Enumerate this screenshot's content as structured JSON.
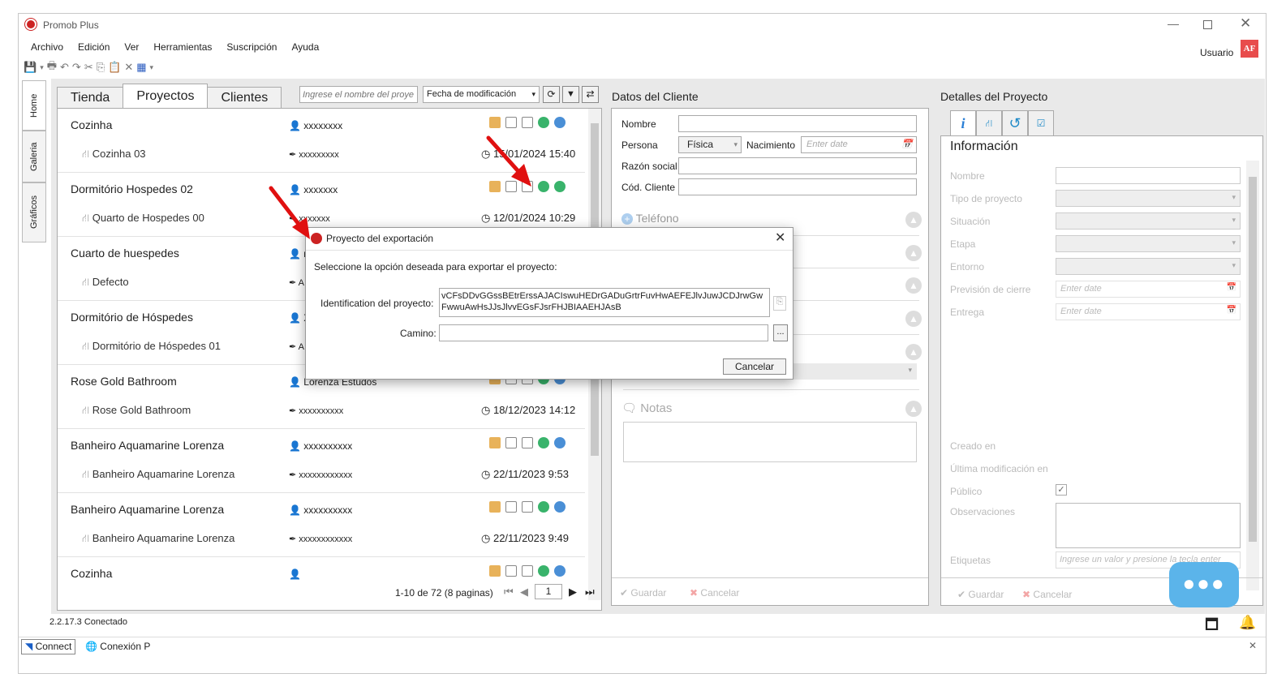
{
  "app": {
    "title": "Promob Plus",
    "user": "Usuario",
    "user_badge": "AF"
  },
  "menu": [
    "Archivo",
    "Edición",
    "Ver",
    "Herramientas",
    "Suscripción",
    "Ayuda"
  ],
  "side_tabs": [
    "Home",
    "Galeria",
    "Gráficos"
  ],
  "projects": {
    "tabs": [
      "Tienda",
      "Proyectos",
      "Clientes"
    ],
    "search_placeholder": "Ingrese el nombre del proye",
    "sort": "Fecha de modificación",
    "rows": [
      {
        "name": "Cozinha",
        "user": "xxxxxxxx",
        "sub": "Cozinha 03",
        "sub_user": "xxxxxxxxx",
        "date": "15/01/2024 15:40"
      },
      {
        "name": "Dormitório Hospedes 02",
        "user": "xxxxxxx",
        "sub": "Quarto de Hospedes 00",
        "sub_user": "xxxxxxx",
        "date": "12/01/2024 10:29"
      },
      {
        "name": "Cuarto de huespedes",
        "user": "r",
        "sub": "Defecto",
        "sub_user": "A",
        "date": ""
      },
      {
        "name": "Dormitório de Hóspedes",
        "user": "X",
        "sub": "Dormitório de Hóspedes 01",
        "sub_user": "A",
        "date": ""
      },
      {
        "name": "Rose Gold Bathroom",
        "user": "Lorenza Estudos",
        "sub": "Rose Gold Bathroom",
        "sub_user": "xxxxxxxxxx",
        "date": "18/12/2023 14:12"
      },
      {
        "name": "Banheiro Aquamarine Lorenza",
        "user": "xxxxxxxxxx",
        "sub": "Banheiro Aquamarine Lorenza",
        "sub_user": "xxxxxxxxxxxx",
        "date": "22/11/2023 9:53"
      },
      {
        "name": "Banheiro Aquamarine Lorenza",
        "user": "xxxxxxxxxx",
        "sub": "Banheiro Aquamarine Lorenza",
        "sub_user": "xxxxxxxxxxxx",
        "date": "22/11/2023 9:49"
      },
      {
        "name": "Cozinha",
        "user": "",
        "sub": "",
        "sub_user": "",
        "date": ""
      }
    ],
    "pager": "1-10 de 72 (8 paginas)",
    "page": "1"
  },
  "client": {
    "title": "Datos del Cliente",
    "nombre": "Nombre",
    "persona": "Persona",
    "persona_val": "Física",
    "nacimiento": "Nacimiento",
    "enter_date": "Enter date",
    "razon": "Razón social",
    "cod": "Cód. Cliente",
    "telefono": "Teléfono",
    "notas": "Notas",
    "guardar": "Guardar",
    "cancelar": "Cancelar"
  },
  "details": {
    "title": "Detalles del Proyecto",
    "info": "Información",
    "labels": [
      "Nombre",
      "Tipo de proyecto",
      "Situación",
      "Etapa",
      "Entorno",
      "Previsión de cierre",
      "Entrega"
    ],
    "enter_date": "Enter date",
    "creado": "Creado en",
    "ultima": "Última modificación en",
    "publico": "Público",
    "obs": "Observaciones",
    "etiquetas": "Etiquetas",
    "etiquetas_ph": "Ingrese un valor y presione la tecla enter",
    "guardar": "Guardar",
    "cancelar": "Cancelar"
  },
  "dialog": {
    "title": "Proyecto del exportación",
    "prompt": "Seleccione la opción deseada para exportar el proyecto:",
    "id_label": "Identification del proyecto:",
    "id_value": "vCFsDDvGGssBEtrErssAJACIswuHEDrGADuGrtrFuvHwAEFEJlvJuwJCDJrwGwFwwuAwHsJJsJlvvEGsFJsrFHJBIAAEHJAsB",
    "path_label": "Camino:",
    "browse": "...",
    "cancel": "Cancelar"
  },
  "status": {
    "version": "2.2.17.3",
    "state": "Conectado",
    "connect": "Connect",
    "conexion": "Conexión P"
  },
  "colors": {
    "accent": "#cc2222",
    "folder": "#e8b25a",
    "cloud_green": "#39b36b",
    "cloud_blue": "#4a8fd6",
    "chat": "#5bb4ea",
    "arrow": "#e01010"
  }
}
